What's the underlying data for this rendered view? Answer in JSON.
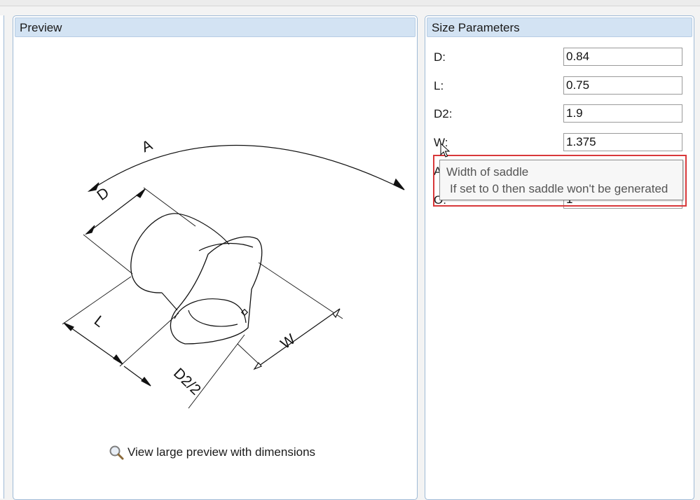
{
  "preview": {
    "title": "Preview",
    "link_label": "View large preview with dimensions",
    "dimension_labels": {
      "A": "A",
      "D": "D",
      "L": "L",
      "W": "W",
      "D2_half": "D2/2"
    }
  },
  "parameters": {
    "title": "Size Parameters",
    "fields": [
      {
        "label": "D:",
        "value": "0.84"
      },
      {
        "label": "L:",
        "value": "0.75"
      },
      {
        "label": "D2:",
        "value": "1.9"
      },
      {
        "label": "W:",
        "value": "1.375"
      },
      {
        "label": "A",
        "value": ""
      },
      {
        "label": "O:",
        "value": "1"
      }
    ]
  },
  "tooltip": {
    "title": "Width of saddle",
    "description": "If set to 0 then saddle won't be generated"
  },
  "colors": {
    "panel_header_bg": "#d3e3f3",
    "panel_border": "#9fbad6",
    "highlight_border": "#d8383a"
  }
}
